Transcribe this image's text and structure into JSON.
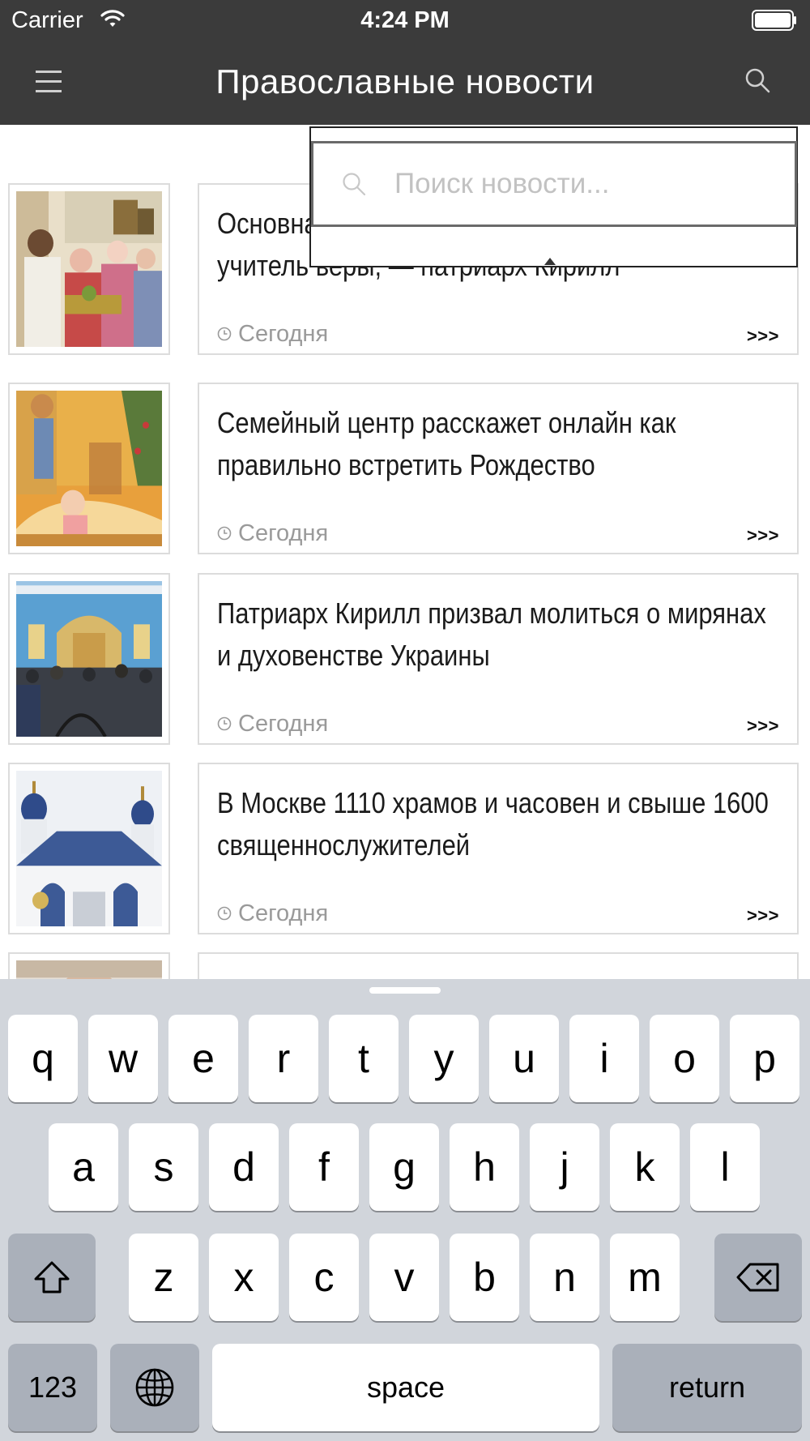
{
  "status_bar": {
    "carrier": "Carrier",
    "time": "4:24 PM"
  },
  "nav": {
    "title": "Православные новости",
    "menu_icon": "hamburger-menu-icon",
    "search_icon": "search-icon"
  },
  "search": {
    "placeholder": "Поиск новости...",
    "value": ""
  },
  "news": [
    {
      "title": "Основная задача священника должен быть учитель веры, — патриарх Кирилл",
      "date": "Сегодня",
      "more": ">>>"
    },
    {
      "title": "Семейный центр расскажет онлайн как правильно встретить Рождество",
      "date": "Сегодня",
      "more": ">>>"
    },
    {
      "title": "Патриарх Кирилл призвал молиться о мирянах и духовенстве Украины",
      "date": "Сегодня",
      "more": ">>>"
    },
    {
      "title": "В Москве 1110 храмов и часовен и свыше 1600 священнослужителей",
      "date": "Сегодня",
      "more": ">>>"
    },
    {
      "title": "",
      "date": "",
      "more": ""
    }
  ],
  "keyboard": {
    "row1": [
      "q",
      "w",
      "e",
      "r",
      "t",
      "y",
      "u",
      "i",
      "o",
      "p"
    ],
    "row2": [
      "a",
      "s",
      "d",
      "f",
      "g",
      "h",
      "j",
      "k",
      "l"
    ],
    "row3": [
      "z",
      "x",
      "c",
      "v",
      "b",
      "n",
      "m"
    ],
    "numbers_label": "123",
    "space_label": "space",
    "return_label": "return"
  },
  "colors": {
    "nav_bg": "#3b3b3b",
    "card_border": "#dcdcdc",
    "keyboard_bg": "#d1d5db"
  }
}
